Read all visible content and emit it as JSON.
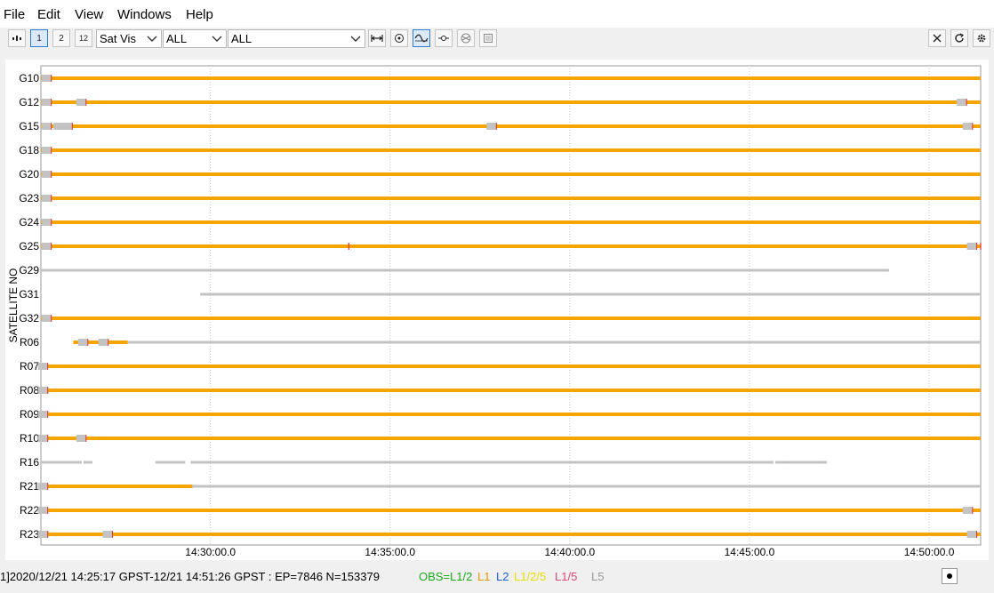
{
  "menu": [
    "File",
    "Edit",
    "View",
    "Windows",
    "Help"
  ],
  "toolbar": {
    "buttons": [
      "1",
      "2",
      "12"
    ],
    "plot_type": "Sat Vis",
    "filter1": "ALL",
    "filter2": "ALL"
  },
  "plot": {
    "ylabel": "SATELLITE NO",
    "time_ticks": [
      "14:30:00.0",
      "14:35:00.0",
      "14:40:00.0",
      "14:45:00.0",
      "14:50:00.0"
    ],
    "colors": {
      "l12": "#f5a400",
      "gray": "#c3c3c3",
      "slip": "#e03030",
      "grid": "#c8c8c8"
    }
  },
  "chart_data": {
    "type": "timeline",
    "x_range": [
      "14:25:17",
      "14:51:26"
    ],
    "satellites": [
      {
        "name": "G10",
        "segments": [
          {
            "type": "l12",
            "start": "14:25:17",
            "end": "14:51:26"
          }
        ]
      },
      {
        "name": "G12",
        "segments": [
          {
            "type": "l12",
            "start": "14:25:17",
            "end": "14:51:26"
          }
        ]
      },
      {
        "name": "G15",
        "segments": [
          {
            "type": "l12",
            "start": "14:25:17",
            "end": "14:51:26"
          }
        ]
      },
      {
        "name": "G18",
        "segments": [
          {
            "type": "l12",
            "start": "14:25:17",
            "end": "14:51:26"
          }
        ]
      },
      {
        "name": "G20",
        "segments": [
          {
            "type": "l12",
            "start": "14:25:17",
            "end": "14:51:26"
          }
        ]
      },
      {
        "name": "G23",
        "segments": [
          {
            "type": "l12",
            "start": "14:25:17",
            "end": "14:51:26"
          }
        ]
      },
      {
        "name": "G24",
        "segments": [
          {
            "type": "l12",
            "start": "14:25:17",
            "end": "14:51:26"
          }
        ]
      },
      {
        "name": "G25",
        "segments": [
          {
            "type": "l12",
            "start": "14:25:17",
            "end": "14:51:26"
          }
        ]
      },
      {
        "name": "G29",
        "segments": [
          {
            "type": "gray",
            "start": "14:25:17",
            "end": "14:48:53"
          }
        ]
      },
      {
        "name": "G31",
        "segments": [
          {
            "type": "gray",
            "start": "14:29:43",
            "end": "14:51:26"
          }
        ]
      },
      {
        "name": "G32",
        "segments": [
          {
            "type": "l12",
            "start": "14:25:17",
            "end": "14:51:26"
          }
        ]
      },
      {
        "name": "R06",
        "segments": [
          {
            "type": "l12",
            "start": "14:26:11",
            "end": "14:27:42"
          },
          {
            "type": "gray",
            "start": "14:27:42",
            "end": "14:51:26"
          }
        ]
      },
      {
        "name": "R07",
        "segments": [
          {
            "type": "l12",
            "start": "14:25:17",
            "end": "14:51:26"
          }
        ]
      },
      {
        "name": "R08",
        "segments": [
          {
            "type": "l12",
            "start": "14:25:17",
            "end": "14:51:26"
          }
        ]
      },
      {
        "name": "R09",
        "segments": [
          {
            "type": "l12",
            "start": "14:25:17",
            "end": "14:51:26"
          }
        ]
      },
      {
        "name": "R10",
        "segments": [
          {
            "type": "l12",
            "start": "14:25:17",
            "end": "14:51:26"
          }
        ]
      },
      {
        "name": "R16",
        "segments": [
          {
            "type": "gray",
            "start": "14:25:17",
            "end": "14:26:25"
          },
          {
            "type": "gray",
            "start": "14:26:28",
            "end": "14:26:43"
          },
          {
            "type": "gray",
            "start": "14:28:28",
            "end": "14:29:18"
          },
          {
            "type": "gray",
            "start": "14:29:27",
            "end": "14:45:40"
          },
          {
            "type": "gray",
            "start": "14:45:43",
            "end": "14:46:02"
          },
          {
            "type": "gray",
            "start": "14:46:02",
            "end": "14:46:58"
          },
          {
            "type": "gray",
            "start": "14:46:58",
            "end": "14:47:09"
          }
        ]
      },
      {
        "name": "R21",
        "segments": [
          {
            "type": "l12",
            "start": "14:25:17",
            "end": "14:29:30"
          },
          {
            "type": "gray",
            "start": "14:29:30",
            "end": "14:51:26"
          }
        ]
      },
      {
        "name": "R22",
        "segments": [
          {
            "type": "l12",
            "start": "14:25:17",
            "end": "14:51:26"
          }
        ]
      },
      {
        "name": "R23",
        "segments": [
          {
            "type": "l12",
            "start": "14:25:17",
            "end": "14:51:26"
          }
        ]
      }
    ],
    "markers": [
      {
        "sat": "G10",
        "times": [
          "14:25:27"
        ]
      },
      {
        "sat": "G12",
        "times": [
          "14:25:27",
          "14:26:25",
          "14:50:55"
        ]
      },
      {
        "sat": "G15",
        "times": [
          "14:25:27",
          "14:25:47",
          "14:26:02",
          "14:37:50",
          "14:51:05"
        ]
      },
      {
        "sat": "G18",
        "times": [
          "14:25:27"
        ]
      },
      {
        "sat": "G20",
        "times": [
          "14:25:27"
        ]
      },
      {
        "sat": "G23",
        "times": [
          "14:25:27"
        ]
      },
      {
        "sat": "G24",
        "times": [
          "14:25:27"
        ]
      },
      {
        "sat": "G25",
        "times": [
          "14:25:27",
          "14:51:12"
        ]
      },
      {
        "sat": "G32",
        "times": [
          "14:25:27"
        ]
      },
      {
        "sat": "R06",
        "times": [
          "14:26:28",
          "14:27:02"
        ]
      },
      {
        "sat": "R07",
        "times": [
          "14:25:21"
        ]
      },
      {
        "sat": "R08",
        "times": [
          "14:25:21"
        ]
      },
      {
        "sat": "R09",
        "times": [
          "14:25:21"
        ]
      },
      {
        "sat": "R10",
        "times": [
          "14:25:21",
          "14:26:25"
        ]
      },
      {
        "sat": "R21",
        "times": [
          "14:25:21"
        ]
      },
      {
        "sat": "R22",
        "times": [
          "14:25:21",
          "14:51:05"
        ]
      },
      {
        "sat": "R23",
        "times": [
          "14:25:21",
          "14:27:09",
          "14:51:12"
        ]
      }
    ],
    "cycle_slips": [
      {
        "sat": "G25",
        "times": [
          "14:33:51",
          "14:51:26"
        ]
      }
    ]
  },
  "status": {
    "text": "1]2020/12/21 14:25:17 GPST-12/21 14:51:26 GPST : EP=7846 N=153379",
    "legend": [
      {
        "label": "OBS=L1/2",
        "color": "#1aaa1a"
      },
      {
        "label": "L1",
        "color": "#e89400"
      },
      {
        "label": "L2",
        "color": "#1f5fd0"
      },
      {
        "label": "L1/2/5",
        "color": "#e8e000"
      },
      {
        "label": "L1/5",
        "color": "#e0457a"
      },
      {
        "label": "L5",
        "color": "#999999"
      }
    ]
  }
}
